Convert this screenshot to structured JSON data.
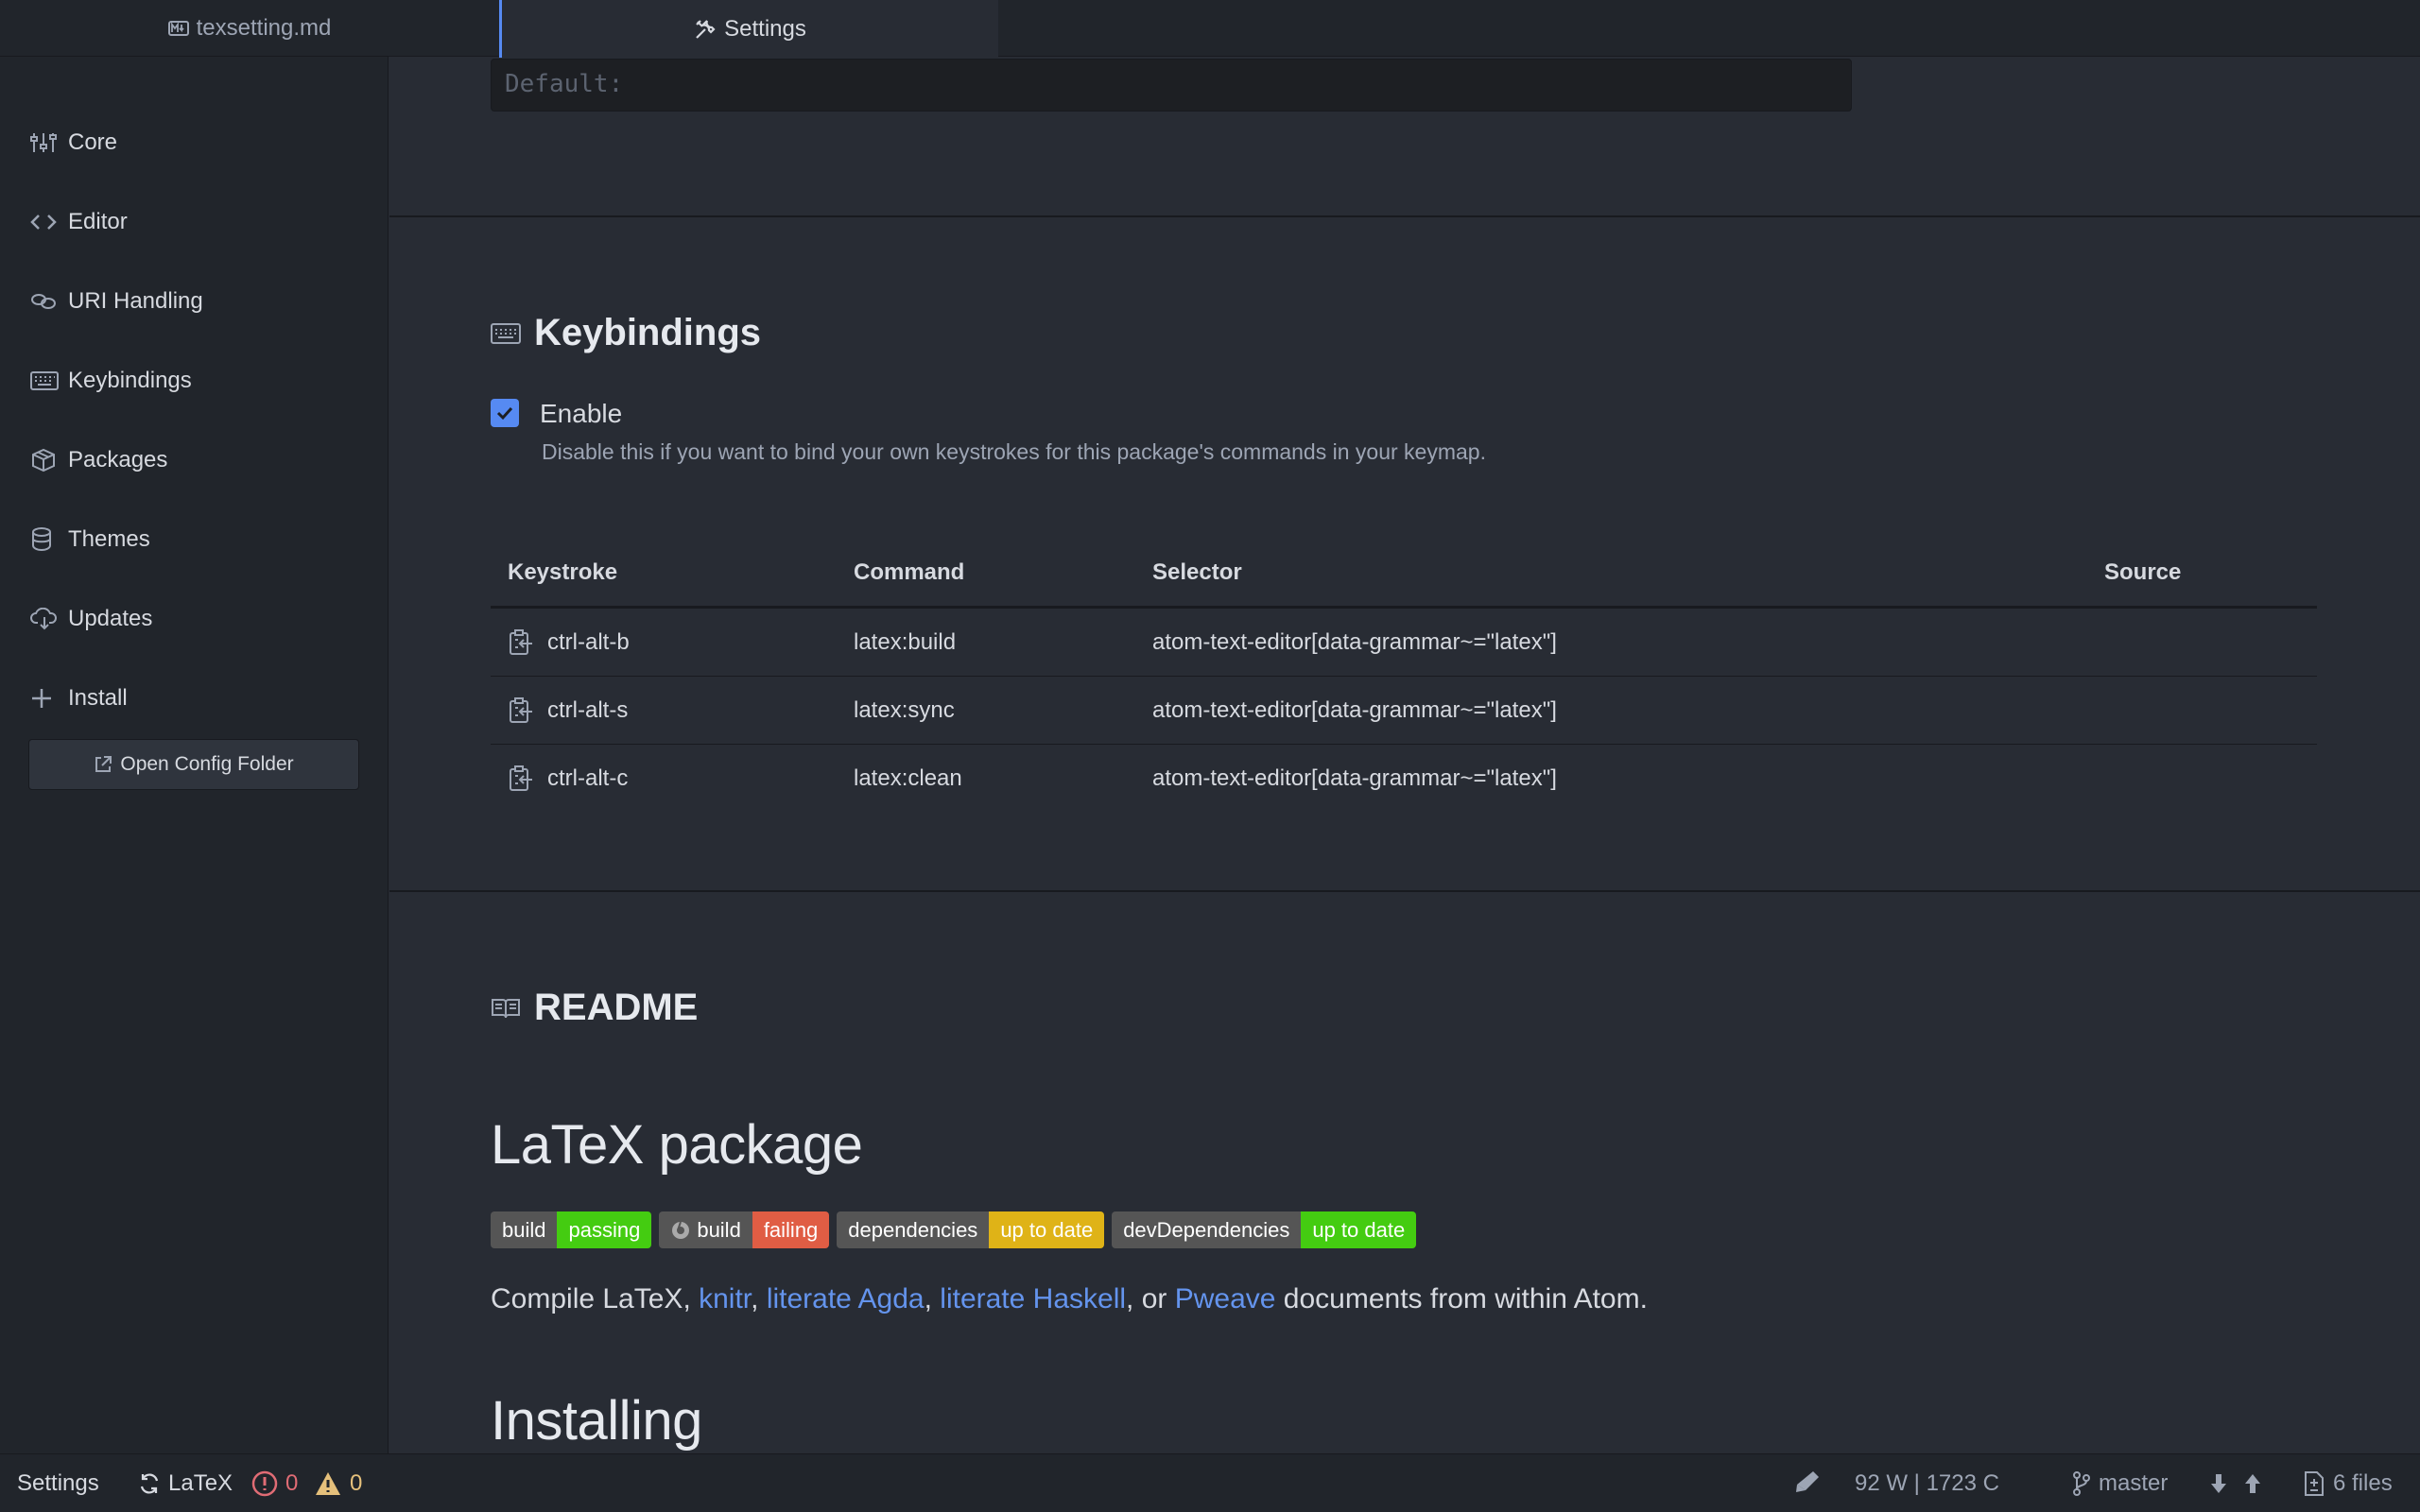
{
  "tabs": [
    {
      "label": "texsetting.md",
      "icon": "markdown-icon"
    },
    {
      "label": "Settings",
      "icon": "tools-icon"
    }
  ],
  "sidebar": {
    "items": [
      {
        "label": "Core",
        "icon": "sliders-icon"
      },
      {
        "label": "Editor",
        "icon": "code-icon"
      },
      {
        "label": "URI Handling",
        "icon": "link-icon"
      },
      {
        "label": "Keybindings",
        "icon": "keyboard-icon"
      },
      {
        "label": "Packages",
        "icon": "package-icon"
      },
      {
        "label": "Themes",
        "icon": "paintcan-icon"
      },
      {
        "label": "Updates",
        "icon": "cloud-download-icon"
      },
      {
        "label": "Install",
        "icon": "plus-icon"
      }
    ],
    "open_config_label": "Open Config Folder"
  },
  "settings": {
    "default_placeholder": "Default:"
  },
  "keybindings": {
    "title": "Keybindings",
    "enable_label": "Enable",
    "enable_checked": true,
    "enable_description": "Disable this if you want to bind your own keystrokes for this package's commands in your keymap.",
    "columns": [
      "Keystroke",
      "Command",
      "Selector",
      "Source"
    ],
    "rows": [
      {
        "keystroke": "ctrl-alt-b",
        "command": "latex:build",
        "selector": "atom-text-editor[data-grammar~=\"latex\"]",
        "source": ""
      },
      {
        "keystroke": "ctrl-alt-s",
        "command": "latex:sync",
        "selector": "atom-text-editor[data-grammar~=\"latex\"]",
        "source": ""
      },
      {
        "keystroke": "ctrl-alt-c",
        "command": "latex:clean",
        "selector": "atom-text-editor[data-grammar~=\"latex\"]",
        "source": ""
      }
    ]
  },
  "readme": {
    "title": "README",
    "heading": "LaTeX package",
    "badges": [
      {
        "label": "build",
        "value": "passing",
        "color": "#44cc11"
      },
      {
        "label": "build",
        "value": "failing",
        "color": "#e05d44",
        "icon": "appveyor-icon"
      },
      {
        "label": "dependencies",
        "value": "up to date",
        "color": "#dfb317"
      },
      {
        "label": "devDependencies",
        "value": "up to date",
        "color": "#44cc11"
      }
    ],
    "text_prefix": "Compile LaTeX, ",
    "link_knitr": "knitr",
    "sep1": ", ",
    "link_agda": "literate Agda",
    "sep2": ", ",
    "link_haskell": "literate Haskell",
    "sep3": ", or ",
    "link_pweave": "Pweave",
    "text_suffix": " documents from within Atom.",
    "heading2": "Installing"
  },
  "statusbar": {
    "left_label": "Settings",
    "grammar": "LaTeX",
    "errors": "0",
    "warnings": "0",
    "word_count": "92 W | 1723 C",
    "branch": "master",
    "files": "6 files"
  },
  "colors": {
    "accent": "#568af2",
    "link": "#6494ed",
    "error": "#e06c75",
    "warning": "#e5c07b"
  }
}
